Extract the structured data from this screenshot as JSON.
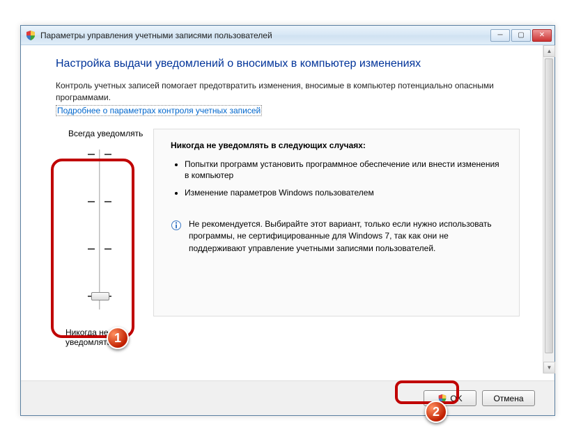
{
  "window": {
    "title": "Параметры управления учетными записями пользователей"
  },
  "heading": "Настройка выдачи уведомлений о вносимых в компьютер изменениях",
  "description": "Контроль учетных записей помогает предотвратить изменения, вносимые в компьютер потенциально опасными программами.",
  "link_text": "Подробнее о параметрах контроля учетных записей",
  "slider": {
    "top_label": "Всегда уведомлять",
    "bottom_label": "Никогда не уведомлять"
  },
  "detail": {
    "title": "Никогда не уведомлять в следующих случаях:",
    "items": [
      "Попытки программ установить программное обеспечение или внести изменения в компьютер",
      "Изменение параметров Windows пользователем"
    ],
    "info": "Не рекомендуется. Выбирайте этот вариант, только если нужно использовать программы, не сертифицированные для Windows 7, так как они не поддерживают управление учетными записями пользователей."
  },
  "buttons": {
    "ok": "OK",
    "cancel": "Отмена"
  },
  "annotations": {
    "badge1": "1",
    "badge2": "2"
  }
}
